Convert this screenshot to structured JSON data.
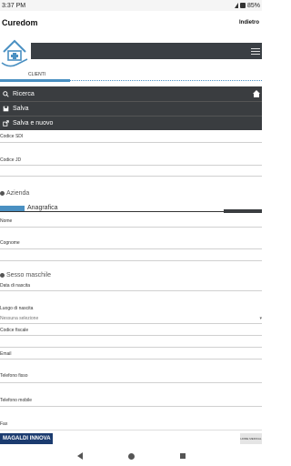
{
  "status_bar": {
    "time": "3:37 PM",
    "battery": "85%"
  },
  "app": {
    "title": "Curedom",
    "back_label": "Indietro"
  },
  "section": {
    "label": "CLIENTI"
  },
  "menu": {
    "items": [
      {
        "label": "Ricerca",
        "icon": "search-icon"
      },
      {
        "label": "Salva",
        "icon": "save-icon"
      },
      {
        "label": "Salva e nuovo",
        "icon": "export-icon"
      }
    ]
  },
  "form": {
    "codice_sdi": "Codice SDI",
    "codice_jd": "Codice JD",
    "azienda": "Azienda",
    "anagrafica": "Anagrafica",
    "nome": "Nome",
    "cognome": "Cognome",
    "sesso": "Sesso maschile",
    "data_nascita": "Data di nascita",
    "luogo_nascita": "Luogo di nascita",
    "luogo_select": "Nessuna selezione",
    "codice_fiscale": "Codice fiscale",
    "email": "Email",
    "telefono_fisso": "Telefono fisso",
    "telefono_mobile": "Telefono mobile",
    "fax": "Fax"
  },
  "footer": {
    "left_logo": "MAGALDI INNOVA",
    "right_logo": "HOME MEDICAL"
  },
  "colors": {
    "accent": "#4a90c2",
    "dark": "#3a3d40",
    "brand_blue": "#1b3b6f"
  }
}
